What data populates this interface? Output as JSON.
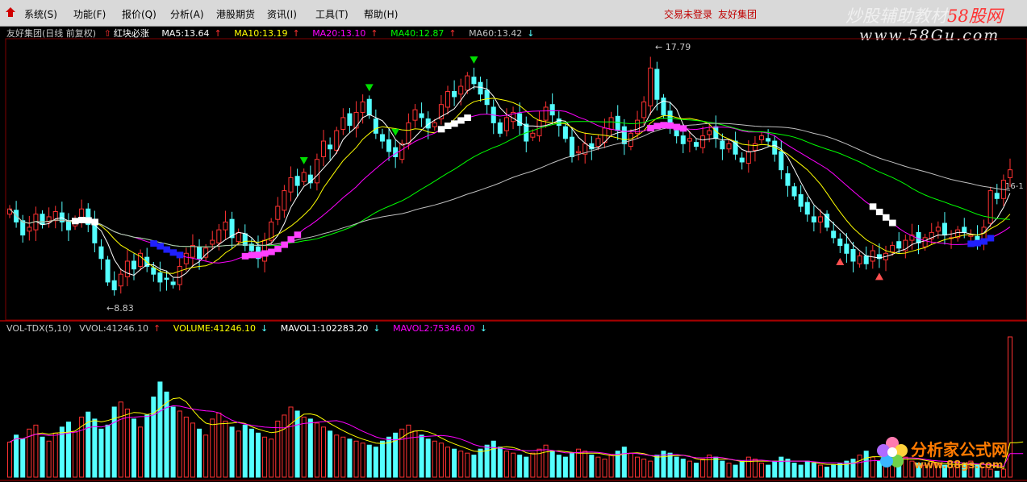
{
  "menu": {
    "items": [
      "系统(S)",
      "功能(F)",
      "报价(Q)",
      "分析(A)",
      "港股期货",
      "资讯(I)",
      "工具(T)",
      "帮助(H)"
    ],
    "status_login": "交易未登录",
    "status_company": "友好集团"
  },
  "watermark": {
    "site1_black": "炒股辅助教材",
    "site1_red": "58股网",
    "site1_url": "www.58Gu.com",
    "site2_name": "分析家公式网",
    "site2_url": "www.88gs.com"
  },
  "main": {
    "title": "友好集团(日线 前复权)",
    "indicator": "红块必涨",
    "ma5": "MA5:13.64",
    "ma10": "MA10:13.19",
    "ma20": "MA20:13.10",
    "ma40": "MA40:12.87",
    "ma60": "MA60:13.42",
    "high_label": "17.79",
    "low_label": "8.83",
    "right_label": "16-1"
  },
  "vol": {
    "title": "VOL-TDX(5,10)",
    "vvol": "VVOL:41246.10",
    "volume": "VOLUME:41246.10",
    "mavol1": "MAVOL1:102283.20",
    "mavol2": "MAVOL2:75346.00"
  },
  "colors": {
    "up": "#ff3232",
    "down": "#54ffff",
    "ma5": "#ffffff",
    "ma10": "#ffff00",
    "ma20": "#ff00ff",
    "ma40": "#00ff00",
    "ma60": "#c0c0c0",
    "separator": "#b00000",
    "pink_block": "#ff40ff",
    "blue_block": "#2020ff"
  },
  "chart_data": {
    "type": "candlestick",
    "ylim": [
      8.0,
      18.5
    ],
    "high": 17.79,
    "low": 8.83,
    "closes": [
      12.1,
      11.6,
      11.1,
      11.4,
      11.9,
      11.5,
      11.8,
      12.0,
      11.6,
      11.3,
      11.7,
      12.1,
      11.5,
      10.8,
      10.2,
      9.3,
      9.0,
      9.6,
      10.1,
      9.8,
      10.4,
      9.9,
      9.6,
      9.3,
      9.4,
      9.2,
      9.9,
      10.4,
      10.7,
      10.2,
      10.6,
      10.9,
      11.3,
      11.6,
      11.0,
      11.2,
      10.7,
      10.5,
      10.2,
      10.9,
      11.6,
      12.2,
      12.8,
      13.3,
      13.0,
      13.5,
      13.1,
      14.0,
      14.7,
      14.4,
      15.1,
      15.6,
      15.3,
      15.8,
      16.2,
      15.7,
      15.0,
      14.7,
      14.3,
      14.1,
      14.6,
      15.4,
      15.9,
      15.6,
      15.2,
      15.4,
      16.1,
      16.6,
      16.4,
      16.8,
      17.2,
      16.9,
      16.5,
      16.1,
      15.4,
      15.0,
      15.6,
      15.8,
      15.3,
      14.7,
      15.0,
      15.5,
      16.0,
      15.7,
      15.3,
      14.8,
      14.1,
      14.3,
      14.6,
      14.4,
      14.8,
      15.2,
      15.6,
      15.1,
      14.6,
      15.0,
      15.5,
      16.2,
      17.5,
      16.3,
      15.7,
      15.2,
      14.9,
      14.6,
      14.8,
      14.5,
      14.9,
      15.1,
      14.8,
      14.4,
      14.6,
      14.2,
      13.9,
      14.3,
      14.6,
      14.9,
      14.7,
      14.2,
      13.6,
      13.0,
      12.6,
      12.2,
      11.9,
      11.6,
      11.8,
      11.4,
      11.0,
      10.7,
      10.4,
      10.1,
      10.3,
      10.0,
      10.5,
      10.2,
      10.4,
      10.7,
      10.6,
      10.9,
      11.1,
      10.8,
      11.0,
      11.2,
      11.4,
      11.1,
      11.0,
      11.3,
      11.2,
      11.1,
      10.9,
      11.4,
      12.8,
      12.5,
      13.2,
      13.6
    ],
    "volumes": [
      35,
      42,
      38,
      48,
      52,
      40,
      36,
      44,
      50,
      55,
      45,
      60,
      65,
      58,
      48,
      52,
      70,
      75,
      68,
      58,
      50,
      62,
      80,
      95,
      85,
      70,
      66,
      60,
      54,
      48,
      42,
      58,
      64,
      56,
      50,
      46,
      52,
      48,
      44,
      40,
      38,
      56,
      62,
      70,
      66,
      60,
      58,
      54,
      50,
      46,
      42,
      40,
      38,
      36,
      34,
      32,
      30,
      36,
      40,
      44,
      48,
      52,
      46,
      42,
      38,
      36,
      34,
      30,
      28,
      26,
      24,
      22,
      28,
      32,
      36,
      30,
      26,
      24,
      22,
      20,
      24,
      28,
      32,
      26,
      22,
      20,
      24,
      28,
      26,
      22,
      20,
      18,
      22,
      26,
      30,
      24,
      20,
      18,
      16,
      22,
      26,
      24,
      20,
      18,
      16,
      14,
      18,
      22,
      20,
      16,
      14,
      12,
      16,
      20,
      18,
      14,
      12,
      16,
      20,
      18,
      14,
      12,
      16,
      14,
      12,
      10,
      12,
      14,
      16,
      18,
      22,
      26,
      20,
      16,
      14,
      18,
      22,
      20,
      16,
      14,
      12,
      16,
      14,
      12,
      10,
      12,
      14,
      16,
      12,
      10,
      8,
      6,
      8,
      140,
      10,
      12
    ],
    "series": [
      {
        "name": "MA5",
        "values": []
      },
      {
        "name": "MA10",
        "values": []
      },
      {
        "name": "MA20",
        "values": []
      },
      {
        "name": "MA40",
        "values": []
      },
      {
        "name": "MA60",
        "values": []
      }
    ]
  }
}
